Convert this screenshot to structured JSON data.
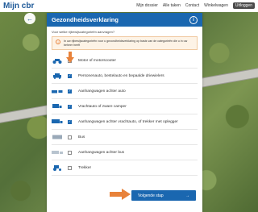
{
  "header": {
    "logo": "Mijn cbr",
    "nav": [
      "Mijn dossier",
      "Alle taken",
      "Contact",
      "Winkelwagen"
    ],
    "logout": "Uitloggen"
  },
  "modal": {
    "title": "Gezondheidsverklaring",
    "subtitle": "Voor welke rijbewijscategorieën aanvragen?",
    "notice": "In uw rijbewijscategorieën voor u gezondheidsverklaring op basis van de categorieën die u in uw beheer heeft",
    "rows": [
      {
        "label": "Motor of motorscooter",
        "checked": false,
        "icon": "motorcycle-icon"
      },
      {
        "label": "Personenauto, bestelauto en bepaalde driewielers",
        "checked": true,
        "icon": "car-icon"
      },
      {
        "label": "Aanhangwagen achter auto",
        "checked": true,
        "icon": "car-trailer-icon"
      },
      {
        "label": "Vrachtauto of zware camper",
        "checked": true,
        "icon": "truck-icon"
      },
      {
        "label": "Aanhangwagen achter vrachtauto, of trekker met oplegger",
        "checked": true,
        "icon": "truck-trailer-icon"
      },
      {
        "label": "Bus",
        "checked": false,
        "icon": "bus-icon"
      },
      {
        "label": "Aanhangwagen achter bus",
        "checked": false,
        "icon": "bus-trailer-icon"
      },
      {
        "label": "Trekker",
        "checked": false,
        "icon": "tractor-icon"
      }
    ],
    "next_label": "Volgende stap"
  },
  "colors": {
    "primary": "#1a67b0",
    "accent": "#e8823a"
  }
}
